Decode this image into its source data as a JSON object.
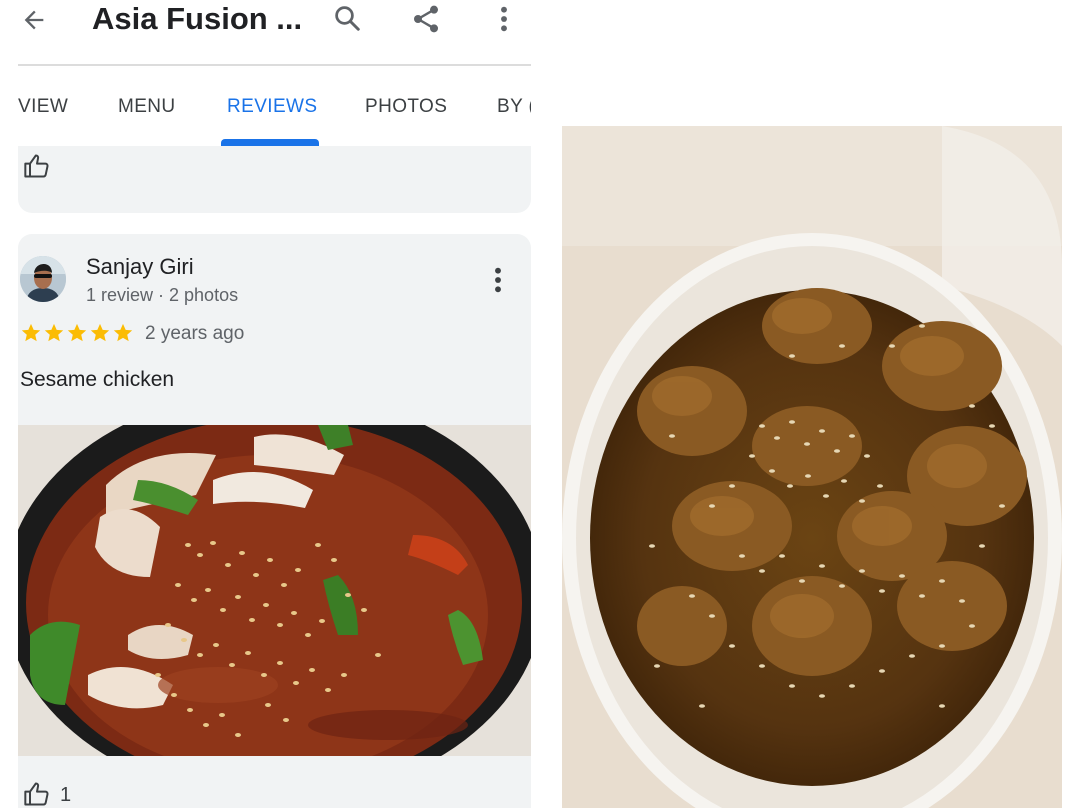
{
  "appbar": {
    "title": "Asia Fusion ...",
    "back_icon": "arrow-back-icon",
    "search_icon": "search-icon",
    "share_icon": "share-icon",
    "more_icon": "more-vert-icon"
  },
  "tabs": [
    {
      "label": "VIEW",
      "active": false
    },
    {
      "label": "MENU",
      "active": false
    },
    {
      "label": "REVIEWS",
      "active": true
    },
    {
      "label": "PHOTOS",
      "active": false
    },
    {
      "label": "BY (",
      "active": false
    }
  ],
  "colors": {
    "accent": "#1a73e8",
    "star": "#fbbc04",
    "card_bg": "#f1f3f4"
  },
  "review": {
    "author": "Sanjay Giri",
    "meta": "1 review · 2 photos",
    "rating": 5,
    "time": "2 years ago",
    "text": "Sesame chicken",
    "likes": "1"
  }
}
